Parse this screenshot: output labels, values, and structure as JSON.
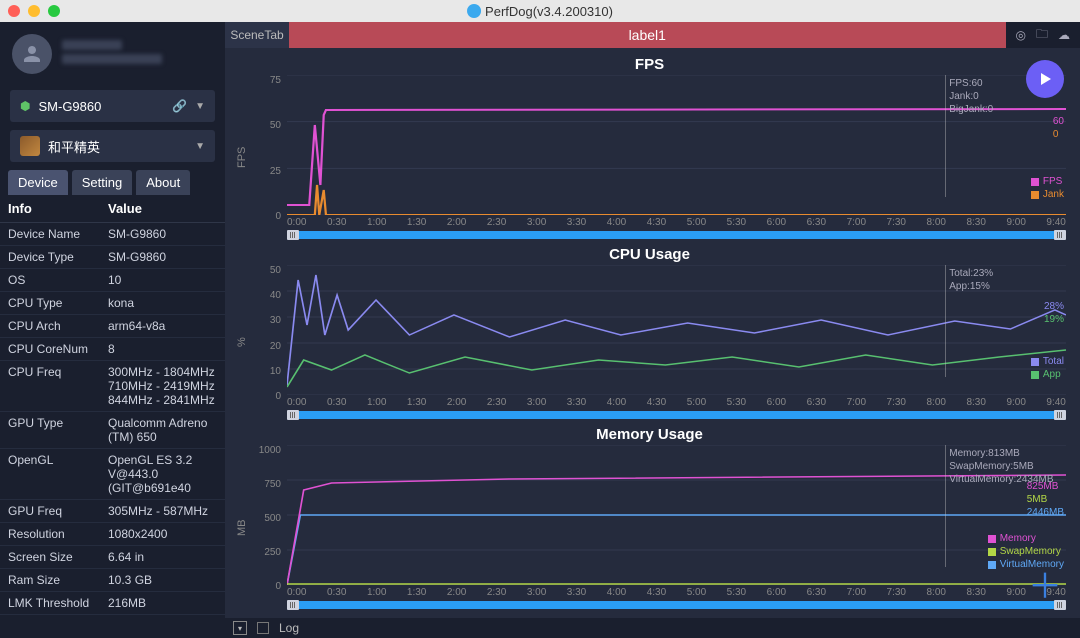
{
  "window": {
    "title": "PerfDog(v3.4.200310)"
  },
  "profile": {
    "name_masked": true
  },
  "device_select": {
    "name": "SM-G9860"
  },
  "app_select": {
    "name": "和平精英"
  },
  "tabs": {
    "device": "Device",
    "setting": "Setting",
    "about": "About"
  },
  "info_headers": {
    "col1": "Info",
    "col2": "Value"
  },
  "info_rows": [
    {
      "k": "Device Name",
      "v": "SM-G9860"
    },
    {
      "k": "Device Type",
      "v": "SM-G9860"
    },
    {
      "k": "OS",
      "v": "10"
    },
    {
      "k": "CPU Type",
      "v": "kona"
    },
    {
      "k": "CPU Arch",
      "v": "arm64-v8a"
    },
    {
      "k": "CPU CoreNum",
      "v": "8"
    },
    {
      "k": "CPU Freq",
      "v": "300MHz - 1804MHz\n710MHz - 2419MHz\n844MHz - 2841MHz"
    },
    {
      "k": "GPU Type",
      "v": "Qualcomm Adreno (TM) 650"
    },
    {
      "k": "OpenGL",
      "v": "OpenGL ES 3.2 V@443.0 (GIT@b691e40"
    },
    {
      "k": "GPU Freq",
      "v": "305MHz - 587MHz"
    },
    {
      "k": "Resolution",
      "v": "1080x2400"
    },
    {
      "k": "Screen Size",
      "v": "6.64 in"
    },
    {
      "k": "Ram Size",
      "v": "10.3 GB"
    },
    {
      "k": "LMK Threshold",
      "v": "216MB"
    }
  ],
  "topbar": {
    "scenetab": "SceneTab",
    "label1": "label1"
  },
  "bottombar": {
    "log": "Log"
  },
  "time_ticks": [
    "0:00",
    "0:30",
    "1:00",
    "1:30",
    "2:00",
    "2:30",
    "3:00",
    "3:30",
    "4:00",
    "4:30",
    "5:00",
    "5:30",
    "6:00",
    "6:30",
    "7:00",
    "7:30",
    "8:00",
    "8:30",
    "9:00",
    "9:40"
  ],
  "colors": {
    "fps": "#e052d3",
    "jank": "#e88b2f",
    "total": "#8a8af0",
    "app": "#58c070",
    "memory": "#e052d3",
    "swap": "#b2d646",
    "virtual": "#5fa8f5"
  },
  "chart_data": [
    {
      "type": "line",
      "title": "FPS",
      "ylabel": "FPS",
      "ylim": [
        0,
        75
      ],
      "y_ticks": [
        75,
        50,
        25,
        0
      ],
      "xlabel_ticks_ref": "time_ticks",
      "series": [
        {
          "name": "FPS",
          "color_ref": "fps",
          "approx": "ramps to ~60 at 0:30, steady ~60 through 9:40 with minor jitter"
        },
        {
          "name": "Jank",
          "color_ref": "jank",
          "approx": "mostly 0 baseline, small spikes near 0:30"
        }
      ],
      "marker": {
        "t": "8:10",
        "lines": [
          "FPS:60",
          "Jank:0",
          "BigJank:0"
        ]
      },
      "right_readouts": [
        {
          "text": "60",
          "color_ref": "fps"
        },
        {
          "text": "0",
          "color_ref": "jank"
        }
      ],
      "legend": [
        {
          "name": "FPS",
          "color_ref": "fps"
        },
        {
          "name": "Jank",
          "color_ref": "jank"
        }
      ]
    },
    {
      "type": "line",
      "title": "CPU Usage",
      "ylabel": "%",
      "ylim": [
        0,
        50
      ],
      "y_ticks": [
        50,
        40,
        30,
        20,
        10,
        0
      ],
      "xlabel_ticks_ref": "time_ticks",
      "series": [
        {
          "name": "Total",
          "color_ref": "total",
          "approx": "spikes ~50 first 30s, settles oscillating 20–30%, rising toward 28% at end"
        },
        {
          "name": "App",
          "color_ref": "app",
          "approx": "starts ~10–15%, oscillates 12–20%, ending ~19%"
        }
      ],
      "marker": {
        "t": "8:10",
        "lines": [
          "Total:23%",
          "App:15%"
        ]
      },
      "right_readouts": [
        {
          "text": "28%",
          "color_ref": "total"
        },
        {
          "text": "19%",
          "color_ref": "app"
        }
      ],
      "legend": [
        {
          "name": "Total",
          "color_ref": "total"
        },
        {
          "name": "App",
          "color_ref": "app"
        }
      ]
    },
    {
      "type": "line",
      "title": "Memory Usage",
      "ylabel": "MB",
      "ylim": [
        0,
        1000
      ],
      "y_ticks": [
        1000,
        750,
        500,
        250,
        0
      ],
      "xlabel_ticks_ref": "time_ticks",
      "series": [
        {
          "name": "Memory",
          "color_ref": "memory",
          "approx": "rises quickly to ~780MB, plateau ~800–825MB"
        },
        {
          "name": "SwapMemory",
          "color_ref": "swap",
          "approx": "flat ~5MB along baseline"
        },
        {
          "name": "VirtualMemory",
          "color_ref": "virtual",
          "approx": "flat plateau ~500 then step-down slightly"
        }
      ],
      "marker": {
        "t": "8:10",
        "lines": [
          "Memory:813MB",
          "SwapMemory:5MB",
          "VirtualMemory:2434MB"
        ]
      },
      "right_readouts": [
        {
          "text": "825MB",
          "color_ref": "memory"
        },
        {
          "text": "5MB",
          "color_ref": "swap"
        },
        {
          "text": "2446MB",
          "color_ref": "virtual"
        }
      ],
      "legend": [
        {
          "name": "Memory",
          "color_ref": "memory"
        },
        {
          "name": "SwapMemory",
          "color_ref": "swap"
        },
        {
          "name": "VirtualMemory",
          "color_ref": "virtual"
        }
      ]
    }
  ]
}
